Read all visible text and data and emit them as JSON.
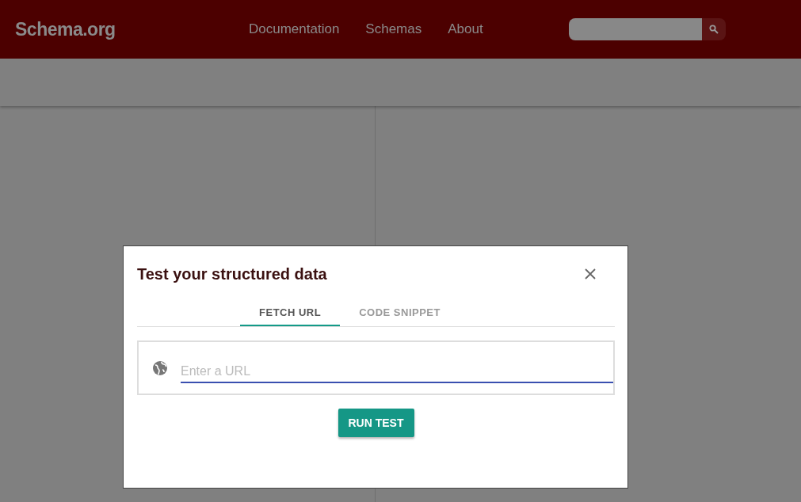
{
  "header": {
    "logo": "Schema.org",
    "nav": [
      "Documentation",
      "Schemas",
      "About"
    ]
  },
  "dialog": {
    "title": "Test your structured data",
    "tabs": [
      {
        "label": "FETCH URL",
        "selected": true
      },
      {
        "label": "CODE SNIPPET",
        "selected": false
      }
    ],
    "url_field": {
      "placeholder": "Enter a URL"
    },
    "run_button": "RUN TEST"
  }
}
